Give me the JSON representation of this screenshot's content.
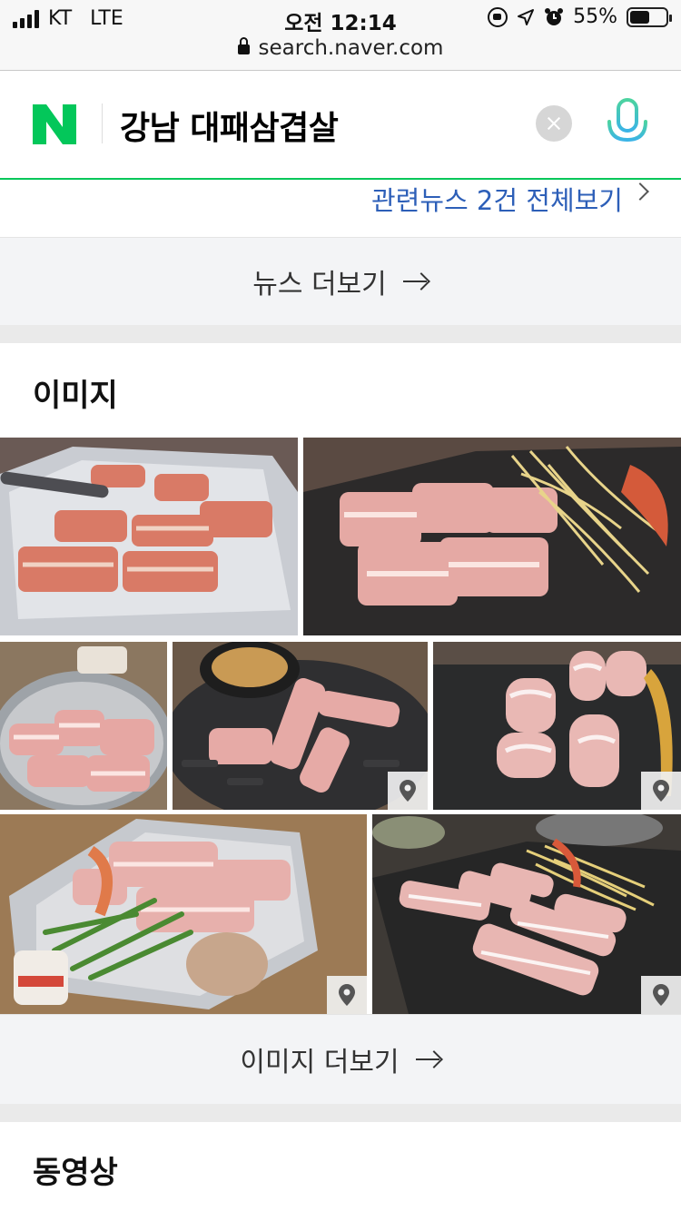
{
  "status_bar": {
    "carrier": "KT",
    "network": "LTE",
    "time": "오전 12:14",
    "url": "search.naver.com",
    "battery": "55%",
    "battery_level": 0.55
  },
  "search": {
    "query": "강남 대패삼겹살",
    "brand_color": "#03c75a"
  },
  "news": {
    "related_link": "관련뉴스 2건 전체보기",
    "more_label": "뉴스 더보기"
  },
  "images": {
    "title": "이미지",
    "more_label": "이미지 더보기",
    "items": [
      {
        "alt": "pork-belly-on-foil"
      },
      {
        "alt": "pork-belly-with-bean-sprouts"
      },
      {
        "alt": "pork-in-strainer"
      },
      {
        "alt": "pork-on-grill-with-stew",
        "has_pin": true
      },
      {
        "alt": "rolled-pork-belly",
        "has_pin": true
      },
      {
        "alt": "pork-with-vegetables-on-foil",
        "has_pin": true
      },
      {
        "alt": "pork-strips-on-black-plate",
        "has_pin": true
      }
    ]
  },
  "videos": {
    "title": "동영상"
  }
}
